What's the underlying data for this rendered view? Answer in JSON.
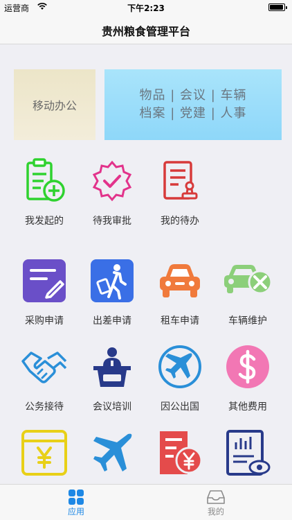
{
  "status": {
    "carrier": "运营商",
    "time": "下午2:23",
    "battery_level": 0.95
  },
  "nav": {
    "title": "贵州粮食管理平台"
  },
  "banner": {
    "left_label": "移动办公",
    "right_line1": "物品 | 会议 | 车辆",
    "right_line2": "档案 | 党建 | 人事"
  },
  "grid": [
    {
      "label": "我发起的",
      "icon": "clipboard-add-icon",
      "color": "#2fd22f"
    },
    {
      "label": "待我审批",
      "icon": "badge-check-icon",
      "color": "#e2338b"
    },
    {
      "label": "我的待办",
      "icon": "document-stamp-icon",
      "color": "#d73a3a"
    },
    {
      "label": "采购申请",
      "icon": "purchase-note-icon",
      "color": "#6a4fc8"
    },
    {
      "label": "出差申请",
      "icon": "traveler-luggage-icon",
      "color": "#3a6fe6"
    },
    {
      "label": "租车申请",
      "icon": "car-icon",
      "color": "#f07a3c"
    },
    {
      "label": "车辆维护",
      "icon": "car-repair-icon",
      "color": "#8ccf7a"
    },
    {
      "label": "公务接待",
      "icon": "handshake-icon",
      "color": "#2a8fd8"
    },
    {
      "label": "会议培训",
      "icon": "podium-speaker-icon",
      "color": "#283a8a"
    },
    {
      "label": "因公出国",
      "icon": "airplane-globe-icon",
      "color": "#2a8fd8"
    },
    {
      "label": "其他费用",
      "icon": "dollar-circle-icon",
      "color": "#f277b4"
    },
    {
      "label": "",
      "icon": "yuan-wallet-icon",
      "color": "#e8d018"
    },
    {
      "label": "",
      "icon": "airplane-icon",
      "color": "#2a8fd8"
    },
    {
      "label": "",
      "icon": "invoice-yuan-icon",
      "color": "#e44b4b"
    },
    {
      "label": "",
      "icon": "report-view-icon",
      "color": "#283a8a"
    }
  ],
  "tabbar": {
    "active": "apps",
    "items": [
      {
        "key": "apps",
        "label": "应用",
        "icon": "grid-apps-icon"
      },
      {
        "key": "mine",
        "label": "我的",
        "icon": "inbox-tray-icon"
      }
    ]
  },
  "colors": {
    "accent": "#1e88e5",
    "inactive": "#8a8a8a"
  }
}
